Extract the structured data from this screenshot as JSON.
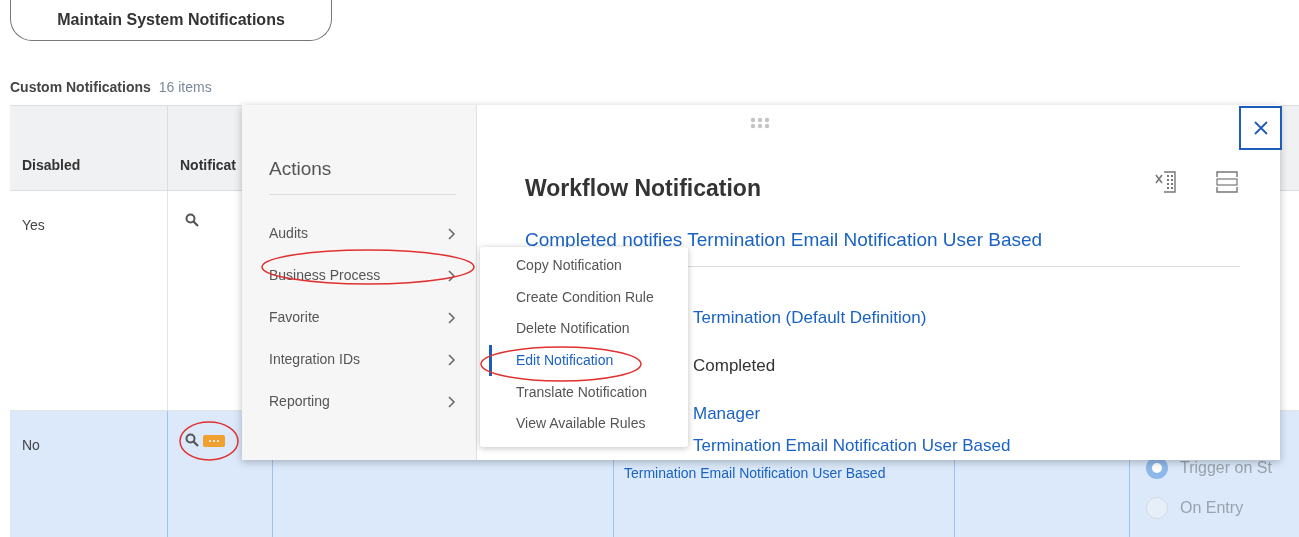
{
  "top_button": {
    "label": "Maintain System Notifications"
  },
  "section": {
    "title": "Custom Notifications",
    "count": "16 items"
  },
  "table": {
    "columns": [
      "Disabled",
      "Notificat"
    ],
    "rows": [
      {
        "disabled": "Yes",
        "selected": false,
        "actions_button": false
      },
      {
        "disabled": "No",
        "selected": true,
        "actions_button": true,
        "link": "Termination Email Notification User Based",
        "radios": [
          {
            "label": "Trigger on St",
            "selected": true
          },
          {
            "label": "On Entry",
            "selected": false
          }
        ]
      }
    ]
  },
  "actions_menu": {
    "title": "Actions",
    "items": [
      {
        "label": "Audits"
      },
      {
        "label": "Business Process"
      },
      {
        "label": "Favorite"
      },
      {
        "label": "Integration IDs"
      },
      {
        "label": "Reporting"
      }
    ]
  },
  "submenu": {
    "items": [
      {
        "label": "Copy Notification",
        "selected": false
      },
      {
        "label": "Create Condition Rule",
        "selected": false
      },
      {
        "label": "Delete Notification",
        "selected": false
      },
      {
        "label": "Edit Notification",
        "selected": true
      },
      {
        "label": "Translate Notification",
        "selected": false
      },
      {
        "label": "View Available Rules",
        "selected": false
      }
    ]
  },
  "detail": {
    "title": "Workflow Notification",
    "subtitle": "Completed notifies Termination Email Notification User Based",
    "fields": [
      {
        "value": "Termination (Default Definition)",
        "kind": "link"
      },
      {
        "value": "Completed",
        "kind": "text"
      },
      {
        "value": "Manager",
        "kind": "link"
      },
      {
        "value": "Termination Email Notification User Based",
        "kind": "link"
      }
    ]
  }
}
